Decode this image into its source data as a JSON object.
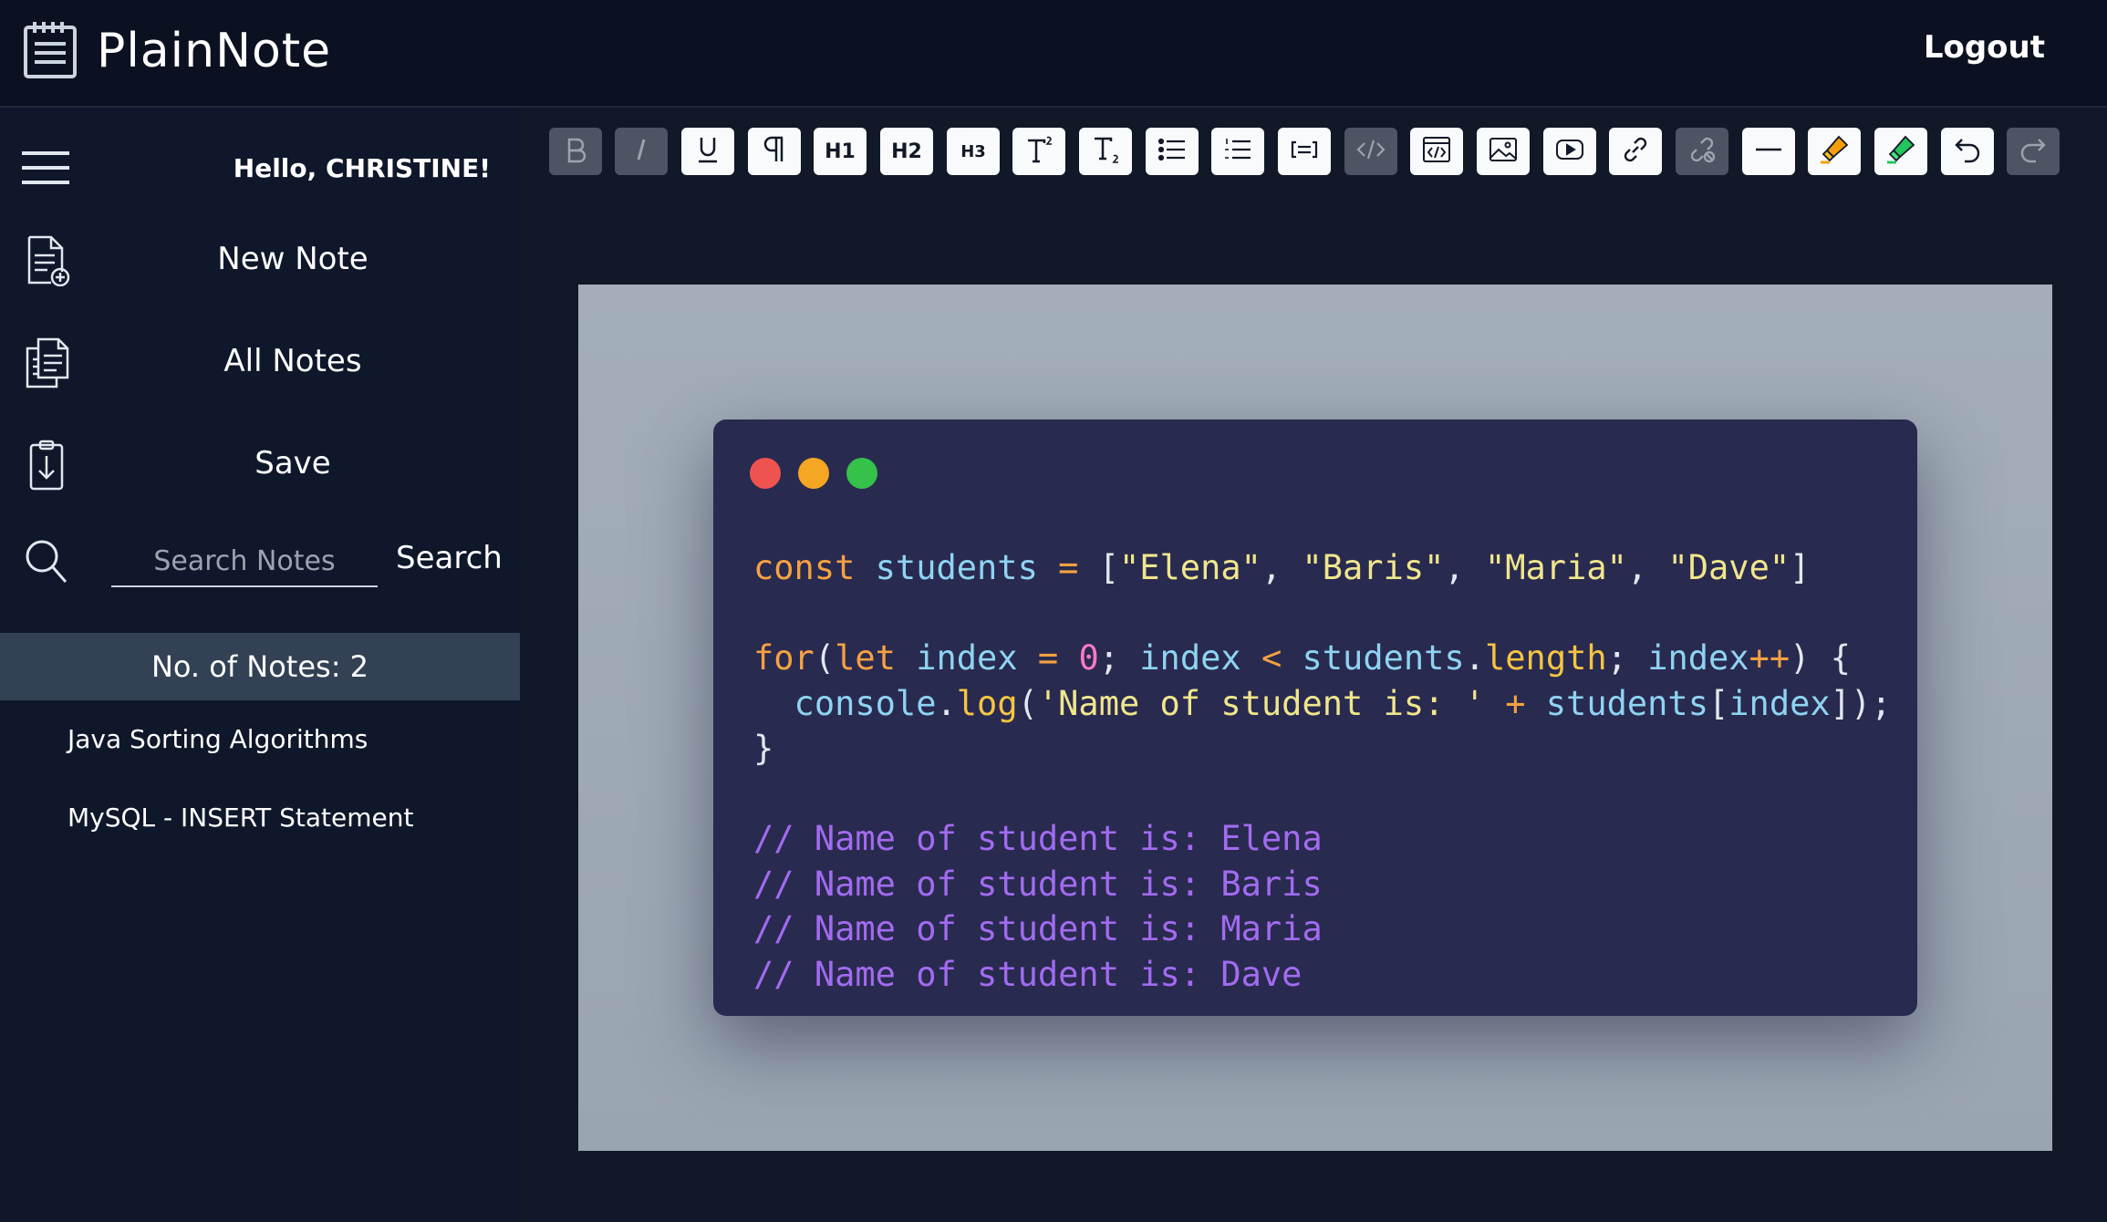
{
  "app": {
    "name": "PlainNote",
    "logout_label": "Logout"
  },
  "sidebar": {
    "greeting": "Hello, CHRISTINE!",
    "nav": [
      {
        "label": "New Note",
        "icon": "new-note-icon"
      },
      {
        "label": "All Notes",
        "icon": "all-notes-icon"
      },
      {
        "label": "Save",
        "icon": "save-icon"
      }
    ],
    "search": {
      "placeholder": "Search Notes",
      "value": "",
      "button_label": "Search"
    },
    "notes_count": "No. of Notes: 2",
    "notes": [
      {
        "title": "Java Sorting Algorithms"
      },
      {
        "title": "MySQL - INSERT Statement"
      }
    ]
  },
  "toolbar": {
    "buttons": [
      {
        "name": "bold",
        "icon": "bold-icon",
        "enabled": false
      },
      {
        "name": "italic",
        "icon": "italic-icon",
        "enabled": false
      },
      {
        "name": "underline",
        "icon": "underline-icon",
        "enabled": true
      },
      {
        "name": "paragraph",
        "icon": "paragraph-icon",
        "enabled": true
      },
      {
        "name": "heading-1",
        "icon": "h1-icon",
        "enabled": true,
        "text": "H1"
      },
      {
        "name": "heading-2",
        "icon": "h2-icon",
        "enabled": true,
        "text": "H2"
      },
      {
        "name": "heading-3",
        "icon": "h3-icon",
        "enabled": true,
        "text": "H3"
      },
      {
        "name": "superscript",
        "icon": "superscript-icon",
        "enabled": true
      },
      {
        "name": "subscript",
        "icon": "subscript-icon",
        "enabled": true
      },
      {
        "name": "bullet-list",
        "icon": "bullet-list-icon",
        "enabled": true
      },
      {
        "name": "ordered-list",
        "icon": "ordered-list-icon",
        "enabled": true
      },
      {
        "name": "blockquote",
        "icon": "blockquote-icon",
        "enabled": true
      },
      {
        "name": "code",
        "icon": "code-icon",
        "enabled": false
      },
      {
        "name": "code-block",
        "icon": "code-block-icon",
        "enabled": true
      },
      {
        "name": "image",
        "icon": "image-icon",
        "enabled": true
      },
      {
        "name": "video",
        "icon": "video-icon",
        "enabled": true
      },
      {
        "name": "link",
        "icon": "link-icon",
        "enabled": true
      },
      {
        "name": "unlink",
        "icon": "unlink-icon",
        "enabled": false
      },
      {
        "name": "horizontal-rule",
        "icon": "horizontal-rule-icon",
        "enabled": true
      },
      {
        "name": "highlight-orange",
        "icon": "highlighter-orange-icon",
        "enabled": true
      },
      {
        "name": "highlight-green",
        "icon": "highlighter-green-icon",
        "enabled": true
      },
      {
        "name": "undo",
        "icon": "undo-icon",
        "enabled": true
      },
      {
        "name": "redo",
        "icon": "redo-icon",
        "enabled": false
      }
    ]
  },
  "editor": {
    "code_image": {
      "window_dot_colors": [
        "#ef5350",
        "#f5a623",
        "#35c14a"
      ],
      "code_lines": [
        [
          {
            "t": "const ",
            "c": "kw"
          },
          {
            "t": "students ",
            "c": "id"
          },
          {
            "t": "= ",
            "c": "kw"
          },
          {
            "t": "[",
            "c": "pl"
          },
          {
            "t": "\"Elena\"",
            "c": "str"
          },
          {
            "t": ", ",
            "c": "pl"
          },
          {
            "t": "\"Baris\"",
            "c": "str"
          },
          {
            "t": ", ",
            "c": "pl"
          },
          {
            "t": "\"Maria\"",
            "c": "str"
          },
          {
            "t": ", ",
            "c": "pl"
          },
          {
            "t": "\"Dave\"",
            "c": "str"
          },
          {
            "t": "]",
            "c": "pl"
          }
        ],
        [],
        [
          {
            "t": "for",
            "c": "kw"
          },
          {
            "t": "(",
            "c": "pl"
          },
          {
            "t": "let ",
            "c": "kw"
          },
          {
            "t": "index ",
            "c": "id"
          },
          {
            "t": "= ",
            "c": "kw"
          },
          {
            "t": "0",
            "c": "num"
          },
          {
            "t": "; ",
            "c": "pl"
          },
          {
            "t": "index ",
            "c": "id"
          },
          {
            "t": "< ",
            "c": "kw"
          },
          {
            "t": "students",
            "c": "id"
          },
          {
            "t": ".",
            "c": "pl"
          },
          {
            "t": "length",
            "c": "fn"
          },
          {
            "t": "; ",
            "c": "pl"
          },
          {
            "t": "index",
            "c": "id"
          },
          {
            "t": "++",
            "c": "kw"
          },
          {
            "t": ") {",
            "c": "pl"
          }
        ],
        [
          {
            "t": "  console",
            "c": "id"
          },
          {
            "t": ".",
            "c": "pl"
          },
          {
            "t": "log",
            "c": "fn"
          },
          {
            "t": "(",
            "c": "pl"
          },
          {
            "t": "'Name of student is: '",
            "c": "str"
          },
          {
            "t": " + ",
            "c": "kw"
          },
          {
            "t": "students",
            "c": "id"
          },
          {
            "t": "[",
            "c": "pl"
          },
          {
            "t": "index",
            "c": "id"
          },
          {
            "t": "]);",
            "c": "pl"
          }
        ],
        [
          {
            "t": "}",
            "c": "pl"
          }
        ],
        [],
        [
          {
            "t": "// Name of student is: Elena",
            "c": "cm"
          }
        ],
        [
          {
            "t": "// Name of student is: Baris",
            "c": "cm"
          }
        ],
        [
          {
            "t": "// Name of student is: Maria",
            "c": "cm"
          }
        ],
        [
          {
            "t": "// Name of student is: Dave",
            "c": "cm"
          }
        ]
      ]
    }
  }
}
